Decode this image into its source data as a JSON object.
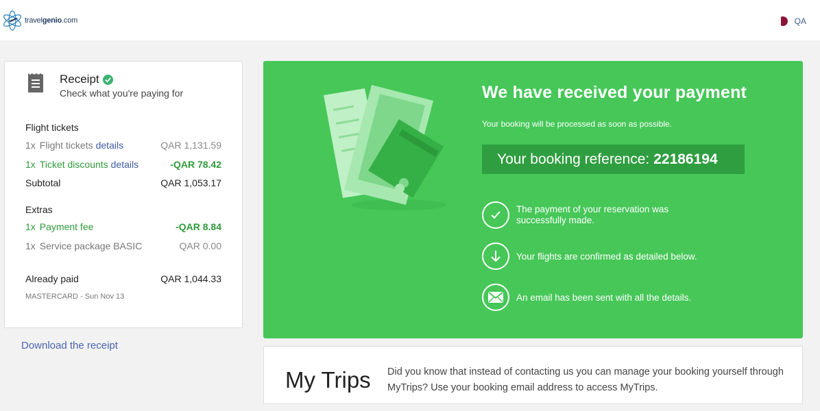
{
  "header": {
    "logo_prefix": "travel",
    "logo_bold": "genio",
    "logo_suffix": ".com",
    "language": "QA"
  },
  "receipt": {
    "title": "Receipt",
    "subtitle": "Check what you're paying for",
    "flight_section": "Flight tickets",
    "items": [
      {
        "qty": "1x",
        "label": "Flight tickets",
        "link": "details",
        "value": "QAR 1,131.59"
      },
      {
        "qty": "1x",
        "label": "Ticket discounts",
        "link": "details",
        "value": "-QAR 78.42"
      }
    ],
    "subtotal_label": "Subtotal",
    "subtotal_value": "QAR 1,053.17",
    "extras_section": "Extras",
    "extras": [
      {
        "qty": "1x",
        "label": "Payment fee",
        "value": "-QAR 8.84"
      },
      {
        "qty": "1x",
        "label": "Service package BASIC",
        "value": "QAR 0.00"
      }
    ],
    "paid_label": "Already paid",
    "paid_value": "QAR 1,044.33",
    "paid_method": "MASTERCARD - Sun Nov 13"
  },
  "download_label": "Download the receipt",
  "banner": {
    "title": "We have received your payment",
    "subtitle": "Your booking will be processed as soon as possible.",
    "ref_label": "Your booking reference:",
    "ref_number": "22186194",
    "statuses": [
      {
        "icon": "check-icon",
        "text": "The payment of your reservation was successfully made."
      },
      {
        "icon": "arrow-down-icon",
        "text": "Your flights are confirmed as detailed below."
      },
      {
        "icon": "envelope-icon",
        "text": "An email has been sent with all the details."
      }
    ],
    "color": "#46c758"
  },
  "mytrips": {
    "title": "My Trips",
    "text": "Did you know that instead of contacting us you can manage your booking yourself through MyTrips? Use your booking email address to access MyTrips."
  }
}
